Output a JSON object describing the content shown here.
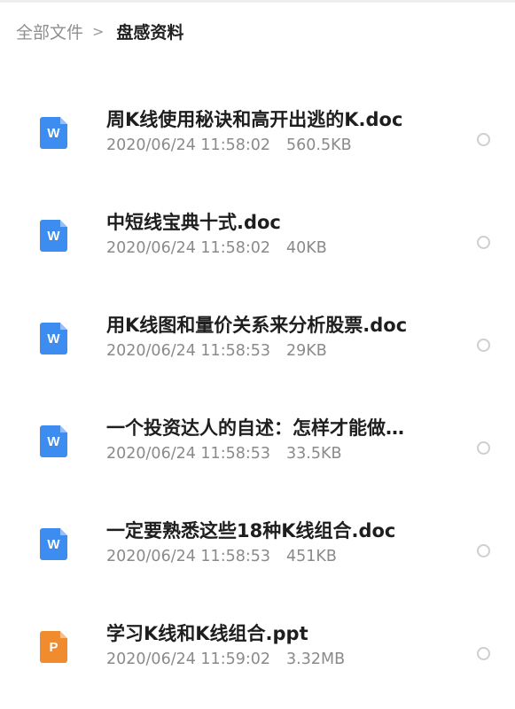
{
  "breadcrumb": {
    "root": "全部文件",
    "separator": ">",
    "current": "盘感资料"
  },
  "files": [
    {
      "name": "周K线使用秘诀和高开出逃的K.doc",
      "date": "2020/06/24 11:58:02",
      "size": "560.5KB",
      "type": "doc",
      "icon_letter": "W",
      "icon": "word-doc-icon"
    },
    {
      "name": "中短线宝典十式.doc",
      "date": "2020/06/24 11:58:02",
      "size": "40KB",
      "type": "doc",
      "icon_letter": "W",
      "icon": "word-doc-icon"
    },
    {
      "name": "用K线图和量价关系来分析股票.doc",
      "date": "2020/06/24 11:58:53",
      "size": "29KB",
      "type": "doc",
      "icon_letter": "W",
      "icon": "word-doc-icon"
    },
    {
      "name": "一个投资达人的自述：怎样才能做…",
      "date": "2020/06/24 11:58:53",
      "size": "33.5KB",
      "type": "doc",
      "icon_letter": "W",
      "icon": "word-doc-icon"
    },
    {
      "name": "一定要熟悉这些18种K线组合.doc",
      "date": "2020/06/24 11:58:53",
      "size": "451KB",
      "type": "doc",
      "icon_letter": "W",
      "icon": "word-doc-icon"
    },
    {
      "name": "学习K线和K线组合.ppt",
      "date": "2020/06/24 11:59:02",
      "size": "3.32MB",
      "type": "ppt",
      "icon_letter": "P",
      "icon": "powerpoint-icon"
    }
  ],
  "colors": {
    "doc_icon": "#3d8cf0",
    "ppt_icon": "#f08b2e",
    "title_text": "#1e1e1e",
    "meta_text": "#8a8a8a"
  }
}
